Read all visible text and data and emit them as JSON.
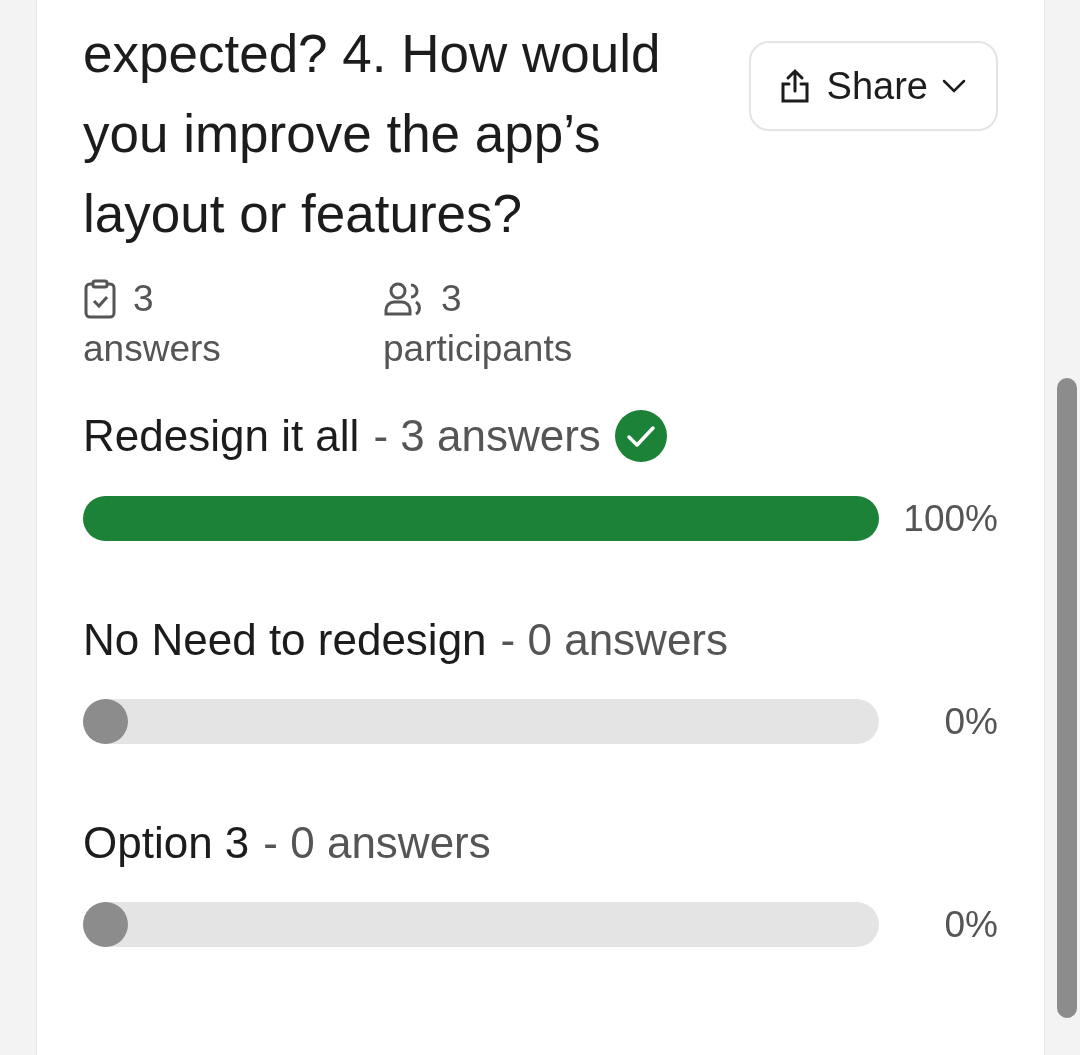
{
  "question": {
    "title": "expected? 4. How would you improve the app’s layout or features?"
  },
  "share_button": {
    "label": "Share"
  },
  "stats": [
    {
      "kind": "answers",
      "value": "3",
      "label": "answers"
    },
    {
      "kind": "participants",
      "value": "3",
      "label": "participants"
    }
  ],
  "options": [
    {
      "label": "Redesign it all",
      "count": "- 3 answers",
      "correct": true,
      "level": 1,
      "percent": "100%"
    },
    {
      "label": "No Need to redesign",
      "count": "- 0 answers",
      "correct": false,
      "level": 0,
      "percent": "0%"
    },
    {
      "label": "Option 3",
      "count": "- 0 answers",
      "correct": false,
      "level": 0,
      "percent": "0%"
    }
  ]
}
